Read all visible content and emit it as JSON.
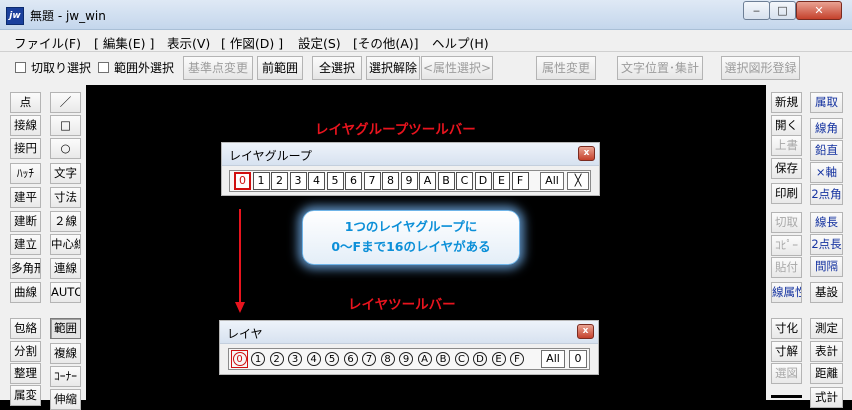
{
  "window": {
    "title": "無題 - jw_win",
    "app_icon": "jw",
    "minimize": "‒",
    "maximize": "□",
    "close": "✕"
  },
  "menu": [
    "ファイル(F)",
    "[ 編集(E) ]",
    "表示(V)",
    "[ 作図(D) ]",
    "設定(S)",
    "[その他(A)]",
    "ヘルプ(H)"
  ],
  "toolbar": {
    "checkbox_cut": "切取り選択",
    "checkbox_outside": "範囲外選択",
    "buttons": [
      "基準点変更",
      "前範囲",
      "全選択",
      "選択解除",
      "<属性選択>",
      "属性変更",
      "文字位置･集計",
      "選択図形登録"
    ]
  },
  "left_tools": [
    [
      "点",
      "／"
    ],
    [
      "接線",
      "□"
    ],
    [
      "接円",
      "○"
    ],
    [
      "ﾊｯﾁ",
      "文字"
    ],
    [
      "建平",
      "寸法"
    ],
    [
      "建断",
      "２線"
    ],
    [
      "建立",
      "中心線"
    ],
    [
      "多角形",
      "連線"
    ],
    [
      "曲線",
      "AUTO"
    ],
    [
      "包絡",
      "範囲"
    ],
    [
      "分割",
      "複線"
    ],
    [
      "整理",
      "ｺｰﾅｰ"
    ],
    [
      "属変",
      "伸縮"
    ]
  ],
  "right_tools": [
    [
      "新規",
      "属取"
    ],
    [
      "開く",
      "線角"
    ],
    [
      "上書",
      "鉛直"
    ],
    [
      "保存",
      "×軸"
    ],
    [
      "印刷",
      "2点角"
    ],
    [
      "切取",
      "線長"
    ],
    [
      "ｺﾋﾟｰ",
      "2点長"
    ],
    [
      "貼付",
      "間隔"
    ],
    [
      "線属性",
      "基設"
    ],
    [
      "寸化",
      "測定"
    ],
    [
      "寸解",
      "表計"
    ],
    [
      "選図",
      "距離"
    ],
    [
      "",
      "式計"
    ]
  ],
  "canvas": {
    "heading_group": "レイヤグループツールバー",
    "heading_layer": "レイヤツールバー",
    "callout_line1": "1つのレイヤグループに",
    "callout_line2": "0〜Fまで16のレイヤがある",
    "arrow_color": "#e8141e"
  },
  "layer_group_toolbar": {
    "title": "レイヤグループ",
    "close": "x",
    "buttons": [
      "0",
      "1",
      "2",
      "3",
      "4",
      "5",
      "6",
      "7",
      "8",
      "9",
      "A",
      "B",
      "C",
      "D",
      "E",
      "F"
    ],
    "selected": "0",
    "all_label": "All",
    "x_label": "╳"
  },
  "layer_toolbar": {
    "title": "レイヤ",
    "close": "x",
    "buttons": [
      "0",
      "1",
      "2",
      "3",
      "4",
      "5",
      "6",
      "7",
      "8",
      "9",
      "A",
      "B",
      "C",
      "D",
      "E",
      "F"
    ],
    "selected": "0",
    "all_label": "All",
    "zero_label": "0"
  }
}
